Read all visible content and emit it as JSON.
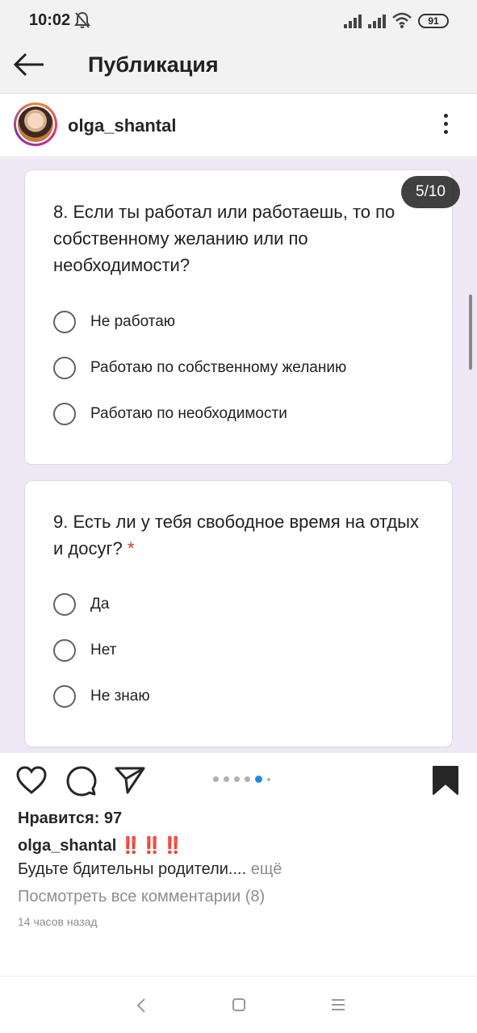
{
  "status_bar": {
    "time": "10:02",
    "battery": "91"
  },
  "header": {
    "title": "Публикация"
  },
  "post": {
    "author": "olga_shantal",
    "slide_counter": "5/10",
    "questions": [
      {
        "text": "8. Если ты работал или работаешь, то по собственному желанию или по необходимости?",
        "required_mark": "",
        "options": [
          "Не работаю",
          "Работаю по собственному желанию",
          "Работаю по необходимости"
        ]
      },
      {
        "text": "9. Есть ли у тебя свободное время на отдых и досуг?",
        "required_mark": "*",
        "options": [
          "Да",
          "Нет",
          "Не знаю"
        ]
      }
    ],
    "likes": "Нравится: 97",
    "caption_author": "olga_shantal",
    "caption_emoji": "‼️‼️‼️",
    "caption_text": "Будьте бдительны родители....",
    "caption_more": " ещё",
    "view_comments": "Посмотреть все комментарии (8)",
    "time_ago": "14 часов назад"
  },
  "icons": {
    "back": "arrow-left-icon",
    "like": "heart-icon",
    "comment": "comment-icon",
    "share": "send-icon",
    "save": "bookmark-icon"
  },
  "colors": {
    "accent_dot": "#1a8cf0",
    "required": "#d93025",
    "form_bg": "#ede7f6"
  }
}
